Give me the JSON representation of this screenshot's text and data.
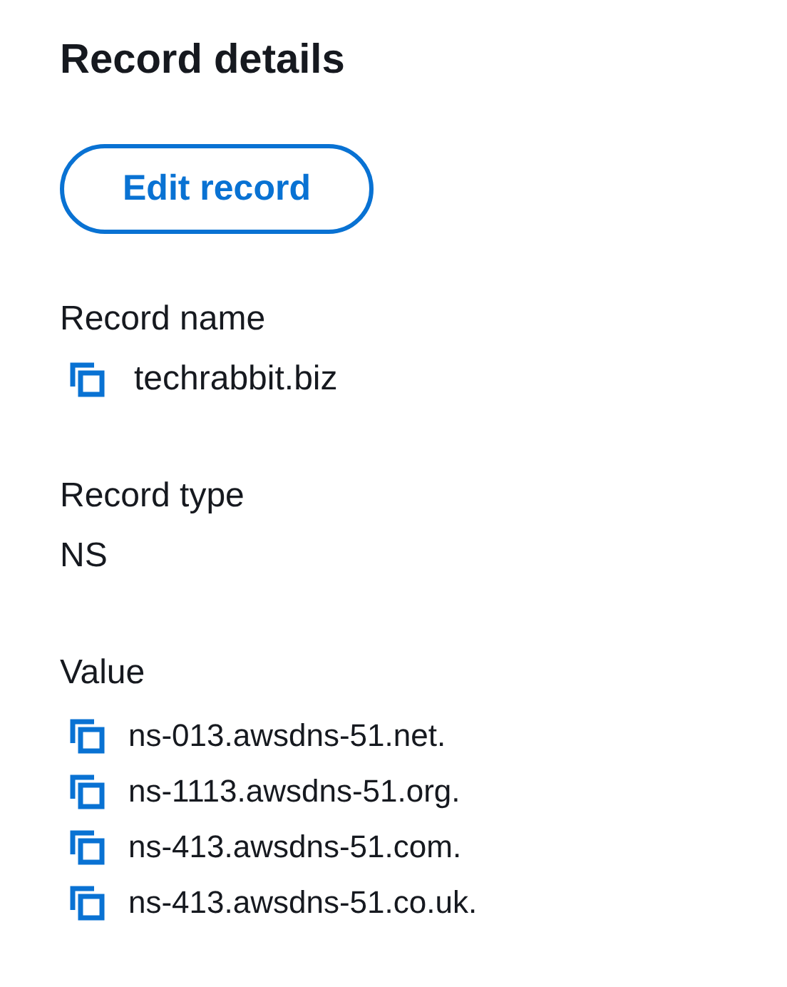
{
  "title": "Record details",
  "edit_button": "Edit record",
  "fields": [
    {
      "label": "Record name",
      "values": [
        "techrabbit.biz"
      ],
      "copyable": true
    },
    {
      "label": "Record type",
      "values": [
        "NS"
      ],
      "copyable": false
    },
    {
      "label": "Value",
      "values": [
        "ns-013.awsdns-51.net.",
        "ns-1113.awsdns-51.org.",
        "ns-413.awsdns-51.com.",
        "ns-413.awsdns-51.co.uk."
      ],
      "copyable": true
    }
  ]
}
